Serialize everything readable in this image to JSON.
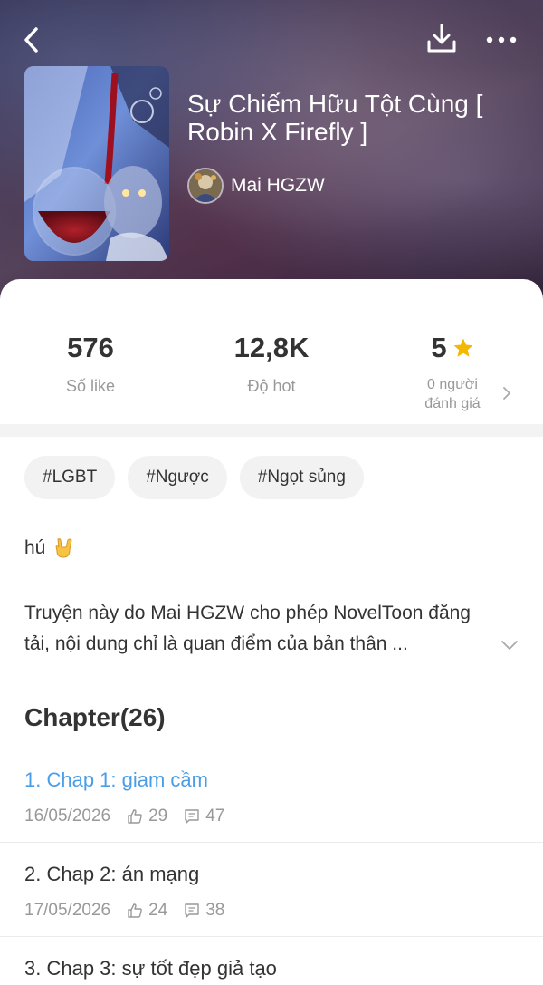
{
  "header": {
    "title": "Sự Chiếm Hữu Tột Cùng [ Robin X Firefly ]",
    "author": "Mai HGZW"
  },
  "stats": {
    "likes_value": "576",
    "likes_label": "Số like",
    "hot_value": "12,8K",
    "hot_label": "Độ hot",
    "rating_value": "5",
    "rating_sub_1": "0 người",
    "rating_sub_2": "đánh giá"
  },
  "tags": [
    "#LGBT",
    "#Ngược",
    "#Ngọt sủng"
  ],
  "description": {
    "short": "hú",
    "long": "Truyện này do Mai HGZW cho phép NovelToon đăng tải, nội dung chỉ là quan điểm của bản thân ..."
  },
  "chapters_heading": "Chapter(26)",
  "chapters": [
    {
      "title": "1. Chap 1: giam cầm",
      "date": "16/05/2026",
      "likes": "29",
      "comments": "47"
    },
    {
      "title": "2. Chap 2: án mạng",
      "date": "17/05/2026",
      "likes": "24",
      "comments": "38"
    },
    {
      "title": "3. Chap 3: sự tốt đẹp giả tạo",
      "date": "",
      "likes": "",
      "comments": ""
    }
  ],
  "colors": {
    "accent_link": "#4a9ee8",
    "star": "#f5b800"
  },
  "icons": [
    "back-icon",
    "download-icon",
    "more-icon",
    "star-icon",
    "chevron-right-icon",
    "chevron-down-icon",
    "rock-hand-emoji",
    "thumbs-up-icon",
    "comment-icon"
  ]
}
